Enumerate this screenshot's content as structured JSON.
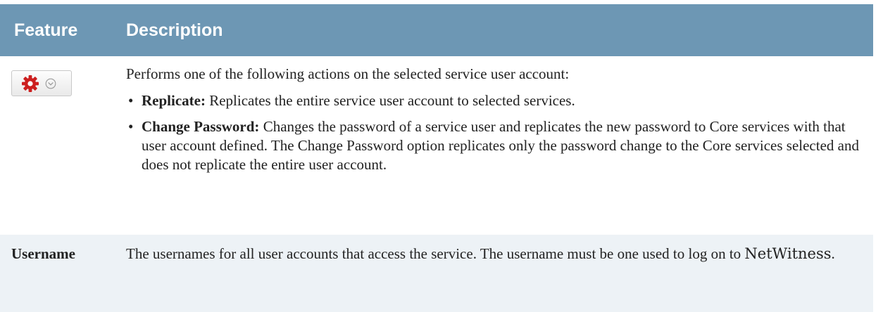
{
  "table": {
    "headers": {
      "feature": "Feature",
      "description": "Description"
    },
    "rows": [
      {
        "feature_icon": "gear-icon",
        "feature_secondary_icon": "chevron-down-icon",
        "intro": "Performs one of the following actions on the selected service user account:",
        "actions": [
          {
            "term": "Replicate:",
            "text": " Replicates the entire service user account to selected services."
          },
          {
            "term": "Change Password:",
            "text": " Changes the password of a service user and replicates the new password to Core services with that user account defined. The Change Password option replicates only the password change to the Core services selected and does not replicate the entire user account."
          }
        ]
      },
      {
        "feature": "Username",
        "description_main": "The usernames for all user accounts that access the service. The username must be one used to log on to ",
        "brand": "NetWitness",
        "description_end": "."
      }
    ]
  },
  "colors": {
    "header_bg": "#6d97b4",
    "header_text": "#ffffff",
    "alt_row_bg": "#edf2f6",
    "gear_red": "#cc1f1f"
  }
}
